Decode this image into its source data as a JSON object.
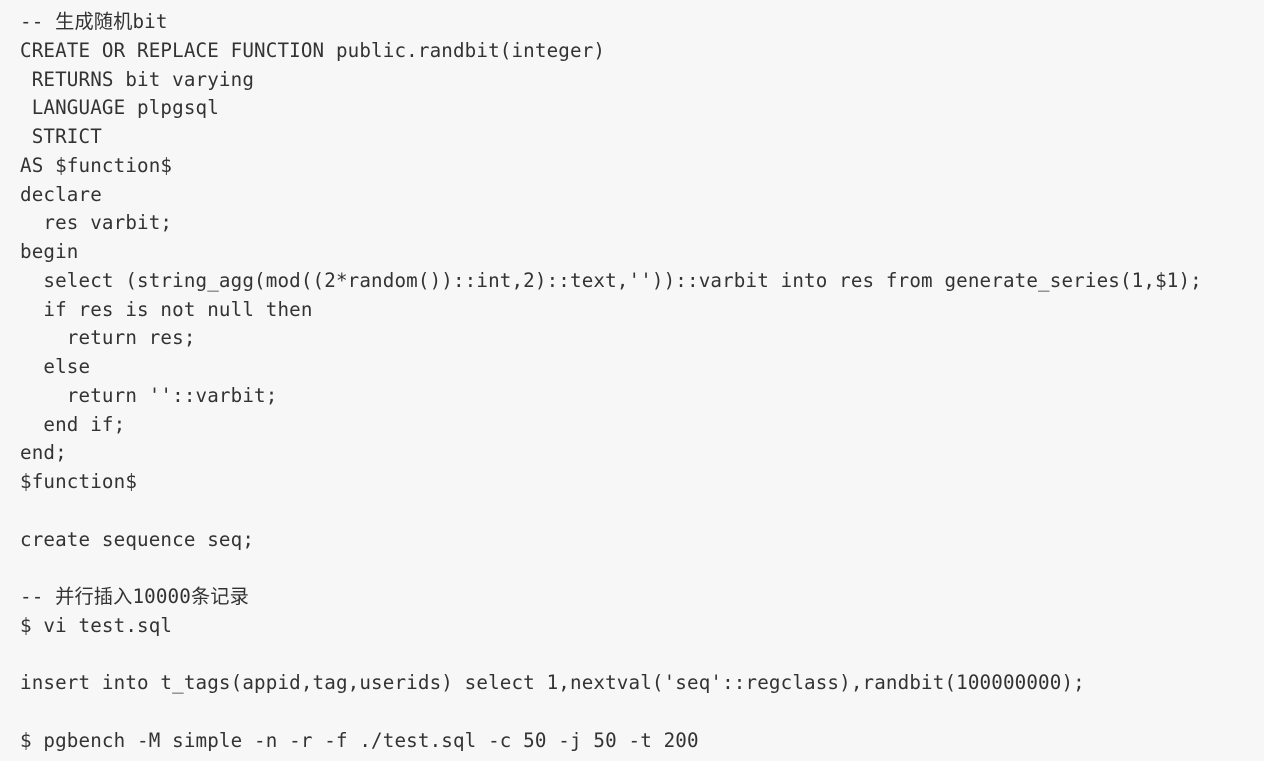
{
  "code_block": {
    "language": "sql",
    "lines": [
      "-- 生成随机bit",
      "CREATE OR REPLACE FUNCTION public.randbit(integer)",
      " RETURNS bit varying",
      " LANGUAGE plpgsql",
      " STRICT",
      "AS $function$",
      "declare",
      "  res varbit;",
      "begin",
      "  select (string_agg(mod((2*random())::int,2)::text,''))::varbit into res from generate_series(1,$1);",
      "  if res is not null then",
      "    return res;",
      "  else",
      "    return ''::varbit;",
      "  end if;",
      "end;",
      "$function$",
      "",
      "create sequence seq;",
      "",
      "-- 并行插入10000条记录",
      "$ vi test.sql",
      "",
      "insert into t_tags(appid,tag,userids) select 1,nextval('seq'::regclass),randbit(100000000);",
      "",
      "$ pgbench -M simple -n -r -f ./test.sql -c 50 -j 50 -t 200"
    ]
  }
}
